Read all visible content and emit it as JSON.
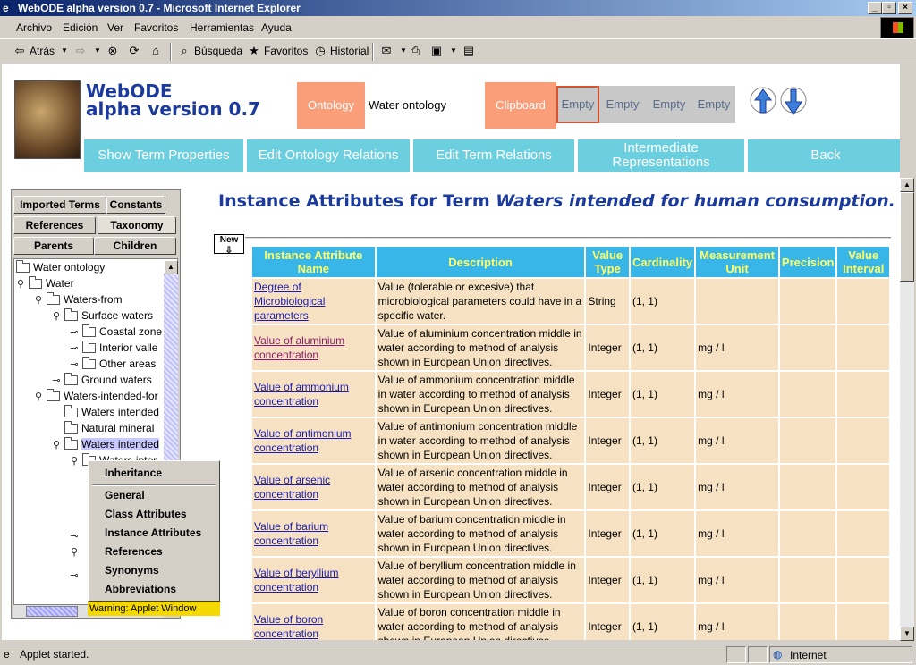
{
  "window": {
    "title": "WebODE alpha version 0.7 - Microsoft Internet Explorer"
  },
  "menu": [
    "Archivo",
    "Edición",
    "Ver",
    "Favoritos",
    "Herramientas",
    "Ayuda"
  ],
  "toolbar": {
    "back": "Atrás",
    "search": "Búsqueda",
    "favorites": "Favoritos",
    "history": "Historial"
  },
  "app": {
    "title_line1": "WebODE",
    "title_line2": "alpha version 0.7"
  },
  "ontology": {
    "label": "Ontology",
    "value": "Water ontology"
  },
  "clipboard": {
    "label": "Clipboard",
    "slots": [
      "Empty",
      "Empty",
      "Empty",
      "Empty"
    ]
  },
  "nav": {
    "show_term_properties": "Show Term Properties",
    "edit_ontology_relations": "Edit Ontology Relations",
    "edit_term_relations": "Edit Term Relations",
    "intermediate_line1": "Intermediate",
    "intermediate_line2": "Representations",
    "back": "Back"
  },
  "tabs": [
    "Imported Terms",
    "Constants",
    "References",
    "Taxonomy",
    "Parents",
    "Children"
  ],
  "tree": [
    "Water ontology",
    "Water",
    "Waters-from",
    "Surface waters",
    "Coastal zone",
    "Interior valle",
    "Other areas",
    "Ground waters",
    "Waters-intended-for",
    "Waters intended",
    "Natural mineral",
    "Waters intended",
    "Waters inter"
  ],
  "context_menu": {
    "top": "Inheritance",
    "items": [
      "General",
      "Class Attributes",
      "Instance Attributes",
      "References",
      "Synonyms",
      "Abbreviations"
    ]
  },
  "warning": "Warning: Applet Window",
  "heading": {
    "prefix": "Instance Attributes for Term ",
    "term": "Waters intended for human consumption."
  },
  "new_label": "New",
  "table": {
    "headers": [
      "Instance Attribute Name",
      "Description",
      "Value Type",
      "Cardinality",
      "Measurement Unit",
      "Precision",
      "Value Interval"
    ],
    "rows": [
      {
        "name": "Degree of Microbiological parameters",
        "desc": "Value (tolerable or excesive) that microbiological parameters could have in a specific water.",
        "type": "String",
        "card": "(1, 1)",
        "unit": "",
        "prec": "",
        "interval": ""
      },
      {
        "name": "Value of aluminium concentration",
        "desc": "Value of aluminium concentration middle in water according to method of analysis shown in European Union directives.",
        "type": "Integer",
        "card": "(1, 1)",
        "unit": "mg / l",
        "prec": "",
        "interval": ""
      },
      {
        "name": "Value of ammonium concentration",
        "desc": "Value of ammonium concentration middle in water according to method of analysis shown in European Union directives.",
        "type": "Integer",
        "card": "(1, 1)",
        "unit": "mg / l",
        "prec": "",
        "interval": ""
      },
      {
        "name": "Value of antimonium concentration",
        "desc": "Value of antimonium concentration middle in water according to method of analysis shown in European Union directives.",
        "type": "Integer",
        "card": "(1, 1)",
        "unit": "mg / l",
        "prec": "",
        "interval": ""
      },
      {
        "name": "Value of arsenic concentration",
        "desc": "Value of arsenic concentration middle in water according to method of analysis shown in European Union directives.",
        "type": "Integer",
        "card": "(1, 1)",
        "unit": "mg / l",
        "prec": "",
        "interval": ""
      },
      {
        "name": "Value of barium concentration",
        "desc": "Value of barium concentration middle in water according to method of analysis shown in European Union directives.",
        "type": "Integer",
        "card": "(1, 1)",
        "unit": "mg / l",
        "prec": "",
        "interval": ""
      },
      {
        "name": "Value of beryllium concentration",
        "desc": "Value of beryllium concentration middle in water according to method of analysis shown in European Union directives.",
        "type": "Integer",
        "card": "(1, 1)",
        "unit": "mg / l",
        "prec": "",
        "interval": ""
      },
      {
        "name": "Value of boron concentration",
        "desc": "Value of boron concentration middle in water according to method of analysis shown in European Union directives.",
        "type": "Integer",
        "card": "(1, 1)",
        "unit": "mg / l",
        "prec": "",
        "interval": ""
      }
    ]
  },
  "status": {
    "text": "Applet started.",
    "zone": "Internet"
  },
  "colors": {
    "accent": "#1c3a9c",
    "salmon": "#fa9e7a",
    "cyan": "#6ccfe0",
    "table_header": "#38b6e8",
    "table_cell": "#f6e2c2"
  }
}
